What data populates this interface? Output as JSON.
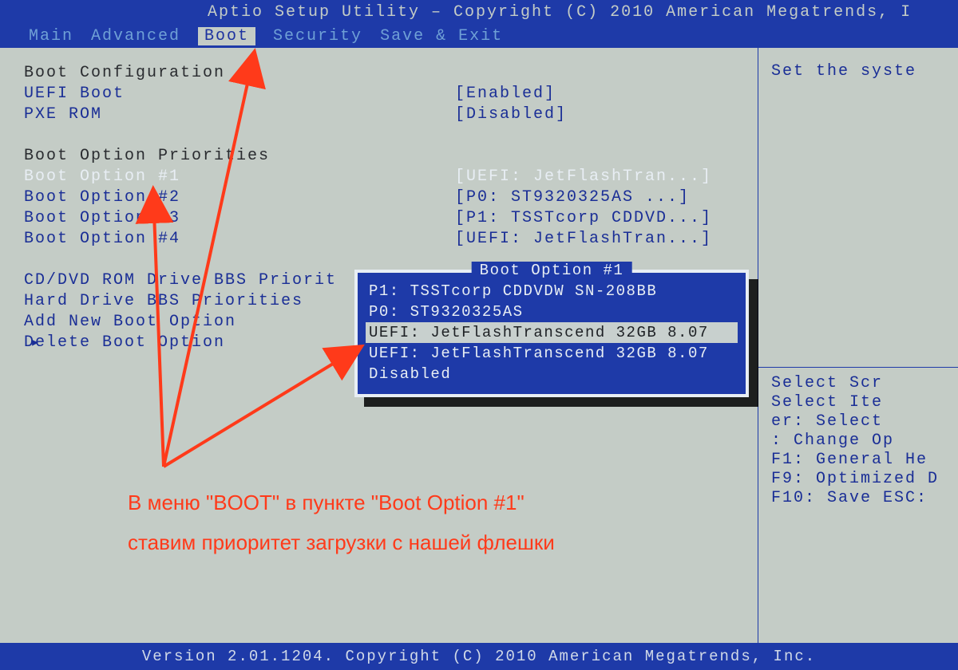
{
  "header": {
    "title": "Aptio Setup Utility – Copyright (C) 2010 American Megatrends, I"
  },
  "tabs": {
    "main": "Main",
    "advanced": "Advanced",
    "boot": "Boot",
    "security": "Security",
    "save_exit": "Save & Exit"
  },
  "boot_config": {
    "heading": "Boot Configuration",
    "uefi_boot": {
      "label": "UEFI Boot",
      "value": "[Enabled]"
    },
    "pxe_rom": {
      "label": "PXE ROM",
      "value": "[Disabled]"
    }
  },
  "priorities": {
    "heading": "Boot Option Priorities",
    "opts": [
      {
        "label": "Boot Option #1",
        "value": "[UEFI: JetFlashTran...]"
      },
      {
        "label": "Boot Option #2",
        "value": "[P0: ST9320325AS   ...]"
      },
      {
        "label": "Boot Option #3",
        "value": "[P1: TSSTcorp CDDVD...]"
      },
      {
        "label": "Boot Option #4",
        "value": "[UEFI: JetFlashTran...]"
      }
    ]
  },
  "more": {
    "cd_dvd": "CD/DVD ROM Drive BBS Priorit",
    "hdd": "Hard Drive BBS Priorities",
    "add": "Add New Boot Option",
    "delete": "Delete Boot Option"
  },
  "right": {
    "top": "Set the syste",
    "help": [
      "    Select Scr",
      "    Select Ite",
      "er: Select",
      "  : Change Op",
      "F1: General He",
      "F9: Optimized D",
      "F10: Save  ESC:"
    ]
  },
  "popup": {
    "title": "Boot Option #1",
    "items": [
      "P1: TSSTcorp CDDVDW SN-208BB",
      "P0: ST9320325AS",
      "UEFI: JetFlashTranscend 32GB 8.07",
      "UEFI: JetFlashTranscend 32GB 8.07",
      "Disabled"
    ],
    "selected_index": 2
  },
  "footer": {
    "version": "Version 2.01.1204. Copyright (C) 2010 American Megatrends, Inc."
  },
  "annotation": {
    "line1": "В меню \"BOOT\" в пункте \"Boot Option #1\"",
    "line2": "ставим приоритет загрузки с нашей флешки"
  }
}
